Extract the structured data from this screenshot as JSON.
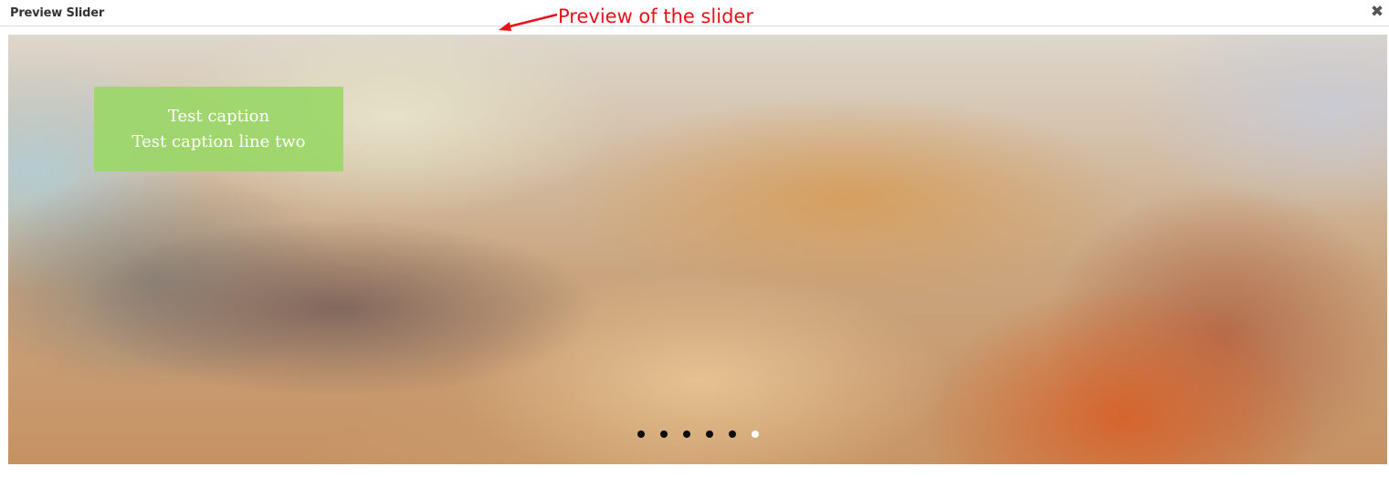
{
  "window": {
    "title": "Preview Slider",
    "close_symbol": "✖",
    "close_icon": "close-icon"
  },
  "annotation": {
    "text": "Preview of the slider",
    "color": "#e8131a"
  },
  "slider": {
    "caption": {
      "line1": "Test caption",
      "line2": "Test caption line two",
      "background": "#9ad767"
    },
    "pagination": {
      "total": 6,
      "active_index": 5
    }
  }
}
